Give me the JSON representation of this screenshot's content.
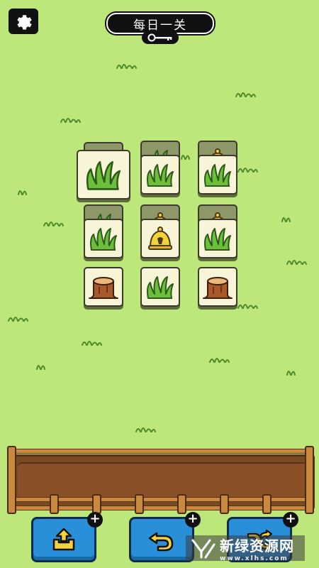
{
  "header": {
    "title": "每日一关",
    "settings_icon": "gear-icon",
    "key_icon": "key-icon"
  },
  "board": {
    "tiles": [
      {
        "item": "grass"
      },
      {
        "item": "grass"
      },
      {
        "item": "grass"
      },
      {
        "item": "grass"
      },
      {
        "item": "bell"
      },
      {
        "item": "grass"
      },
      {
        "item": "stump"
      },
      {
        "item": "grass"
      },
      {
        "item": "stump"
      }
    ],
    "under_tiles": [
      {
        "item": "bell"
      },
      {
        "item": "grass"
      },
      {
        "item": "bell"
      },
      {
        "item": "grass"
      },
      {
        "item": "bell"
      },
      {
        "item": "bell"
      }
    ]
  },
  "powerups": [
    {
      "name": "shuffle-out",
      "icon": "tile-out-icon",
      "badge": "+"
    },
    {
      "name": "undo",
      "icon": "undo-icon",
      "badge": "+"
    },
    {
      "name": "shuffle",
      "icon": "shuffle-icon",
      "badge": "+"
    }
  ],
  "watermark": {
    "title": "新绿资源网",
    "sub": "www.xlhs.com"
  },
  "colors": {
    "background": "#bde77a",
    "tile": "#f7f4d8",
    "button": "#2a8fd9",
    "tray": "#7a4a22"
  }
}
